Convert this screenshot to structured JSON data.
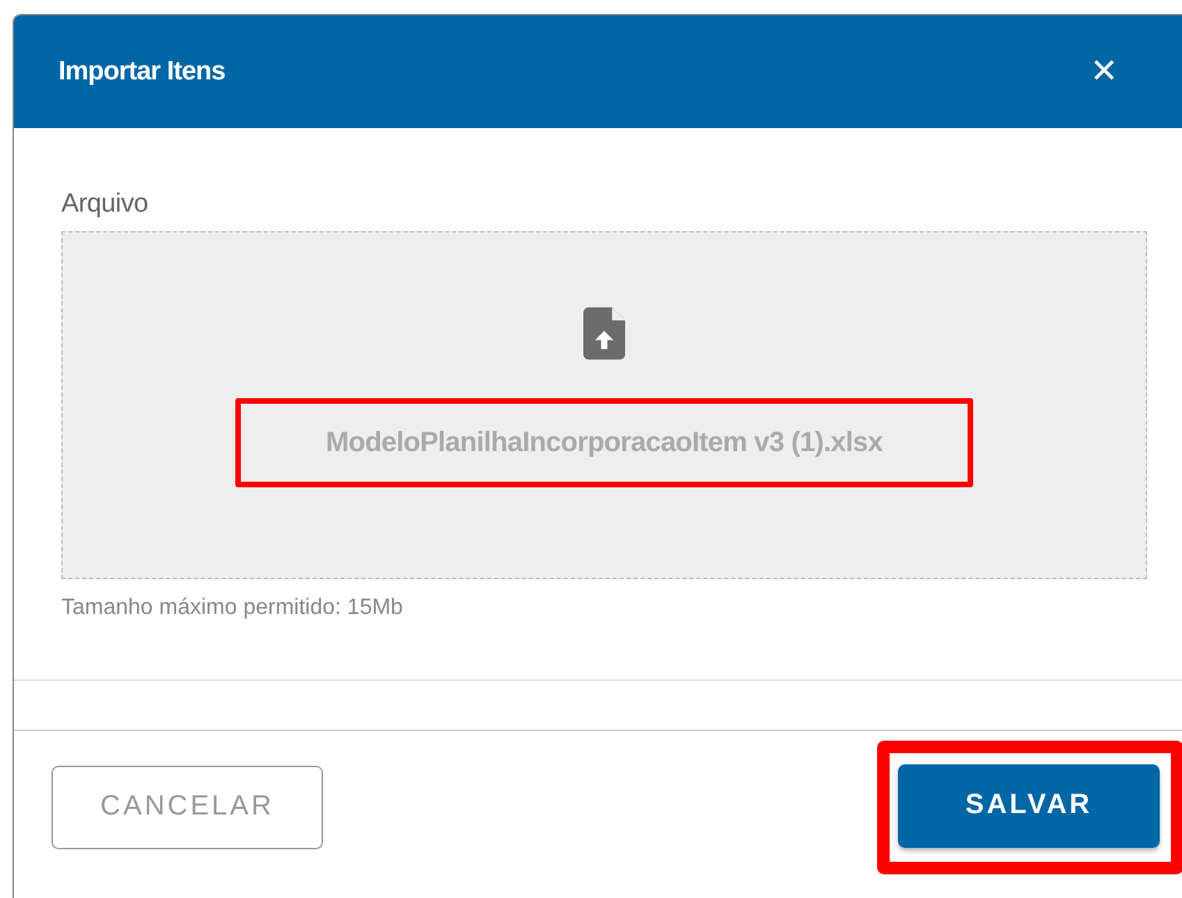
{
  "dialog": {
    "title": "Importar Itens",
    "close": "✕"
  },
  "field": {
    "label": "Arquivo",
    "file_name": "ModeloPlanilhaIncorporacaoItem v3 (1).xlsx",
    "file_name_highlighted": true,
    "hint": "Tamanho máximo permitido: 15Mb"
  },
  "buttons": [
    {
      "label": "CANCELAR",
      "kind": "outline",
      "highlighted": false
    },
    {
      "label": "SALVAR",
      "kind": "primary",
      "highlighted": true
    }
  ]
}
